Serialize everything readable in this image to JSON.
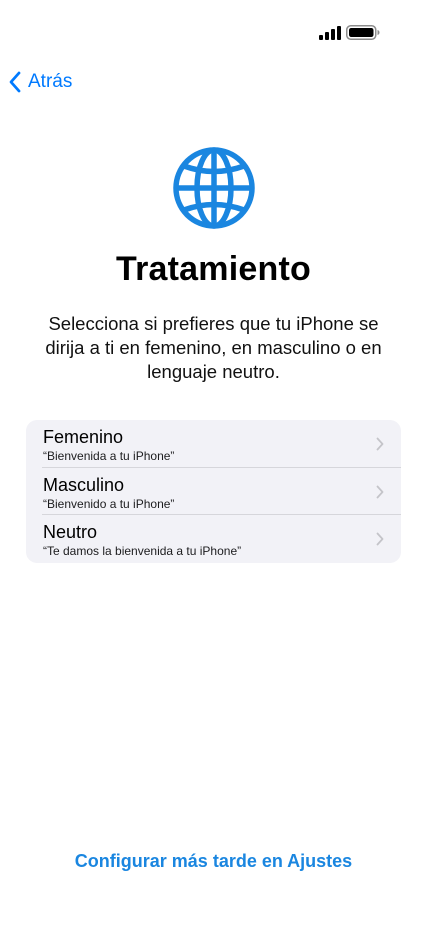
{
  "status_bar": {
    "signal_icon": "cellular-signal-icon",
    "battery_icon": "battery-full-icon"
  },
  "navigation": {
    "back_label": "Atrás",
    "back_icon": "chevron-left-icon"
  },
  "header": {
    "icon": "globe-icon",
    "title": "Tratamiento",
    "description": "Selecciona si prefieres que tu iPhone se dirija a ti en femenino, en masculino o en lenguaje neutro."
  },
  "options": [
    {
      "title": "Femenino",
      "subtitle": "“Bienvenida a tu iPhone”"
    },
    {
      "title": "Masculino",
      "subtitle": "“Bienvenido a tu iPhone”"
    },
    {
      "title": "Neutro",
      "subtitle": "“Te damos la bienvenida a tu iPhone”"
    }
  ],
  "footer": {
    "later_label": "Configurar más tarde en Ajustes"
  },
  "colors": {
    "accent": "#007aff",
    "link": "#1a86e0",
    "list_background": "#f2f2f7",
    "chevron": "#c4c4c9"
  }
}
